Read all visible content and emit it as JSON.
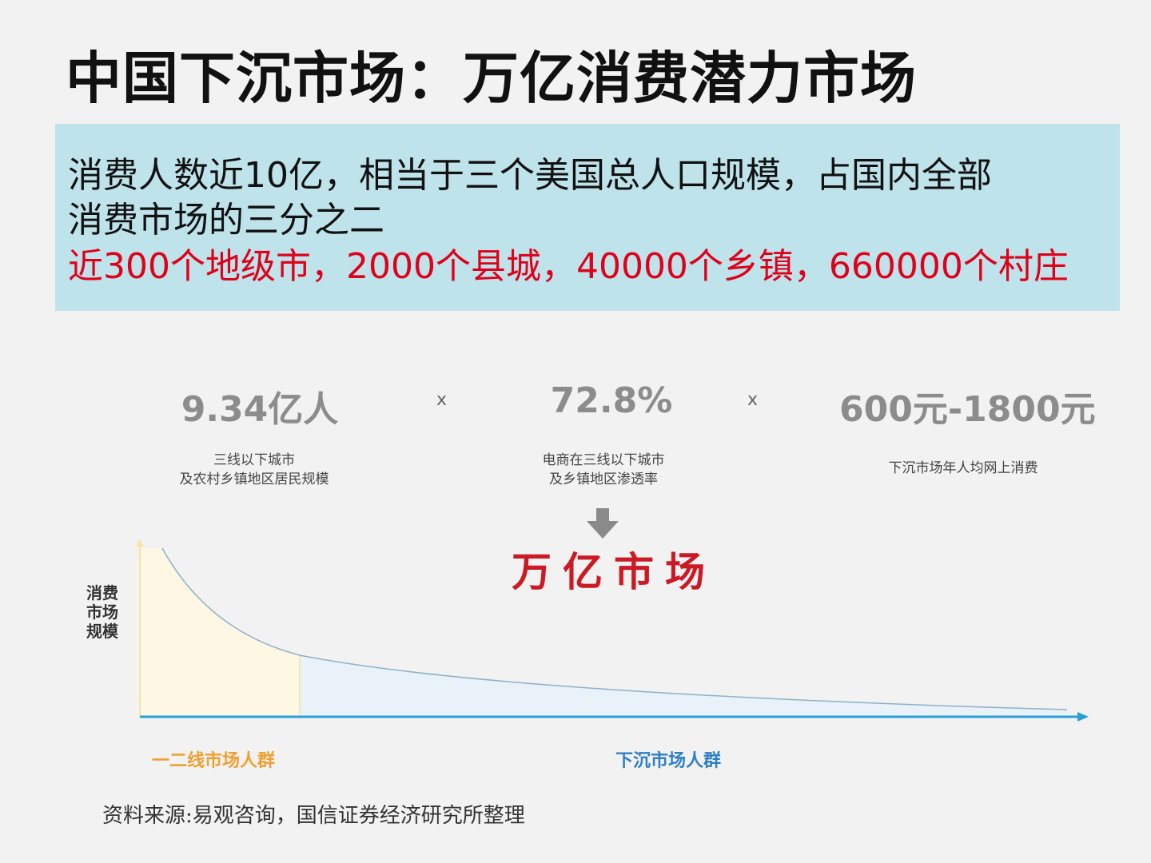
{
  "title": "中国下沉市场：万亿消费潜力市场",
  "info": {
    "line1": "消费人数近10亿，相当于三个美国总人口规模，占国内全部",
    "line2": "消费市场的三分之二",
    "line3": "近300个地级市，2000个县城，40000个乡镇，660000个村庄"
  },
  "metrics": [
    {
      "value": "9.34亿人",
      "caption1": "三线以下城市",
      "caption2": "及农村乡镇地区居民规模"
    },
    {
      "value": "72.8%",
      "caption1": "电商在三线以下城市",
      "caption2": "及乡镇地区渗透率"
    },
    {
      "value": "600元-1800元",
      "caption1": "下沉市场年人均网上消费",
      "caption2": ""
    }
  ],
  "operator": "x",
  "result": "万亿市场",
  "chart": {
    "ylabel_lines": [
      "消费",
      "市场",
      "规模"
    ],
    "x_left_label": "一二线市场人群",
    "x_right_label": "下沉市场人群"
  },
  "colors": {
    "info_bg": "#bfe3ea",
    "highlight_red": "#e0001a",
    "result_red": "#cc1a25",
    "axis_blue": "#2a9fd6",
    "left_label_orange": "#f0a030",
    "right_label_blue": "#2f7fc4"
  },
  "source": "资料来源:易观咨询，国信证券经济研究所整理"
}
